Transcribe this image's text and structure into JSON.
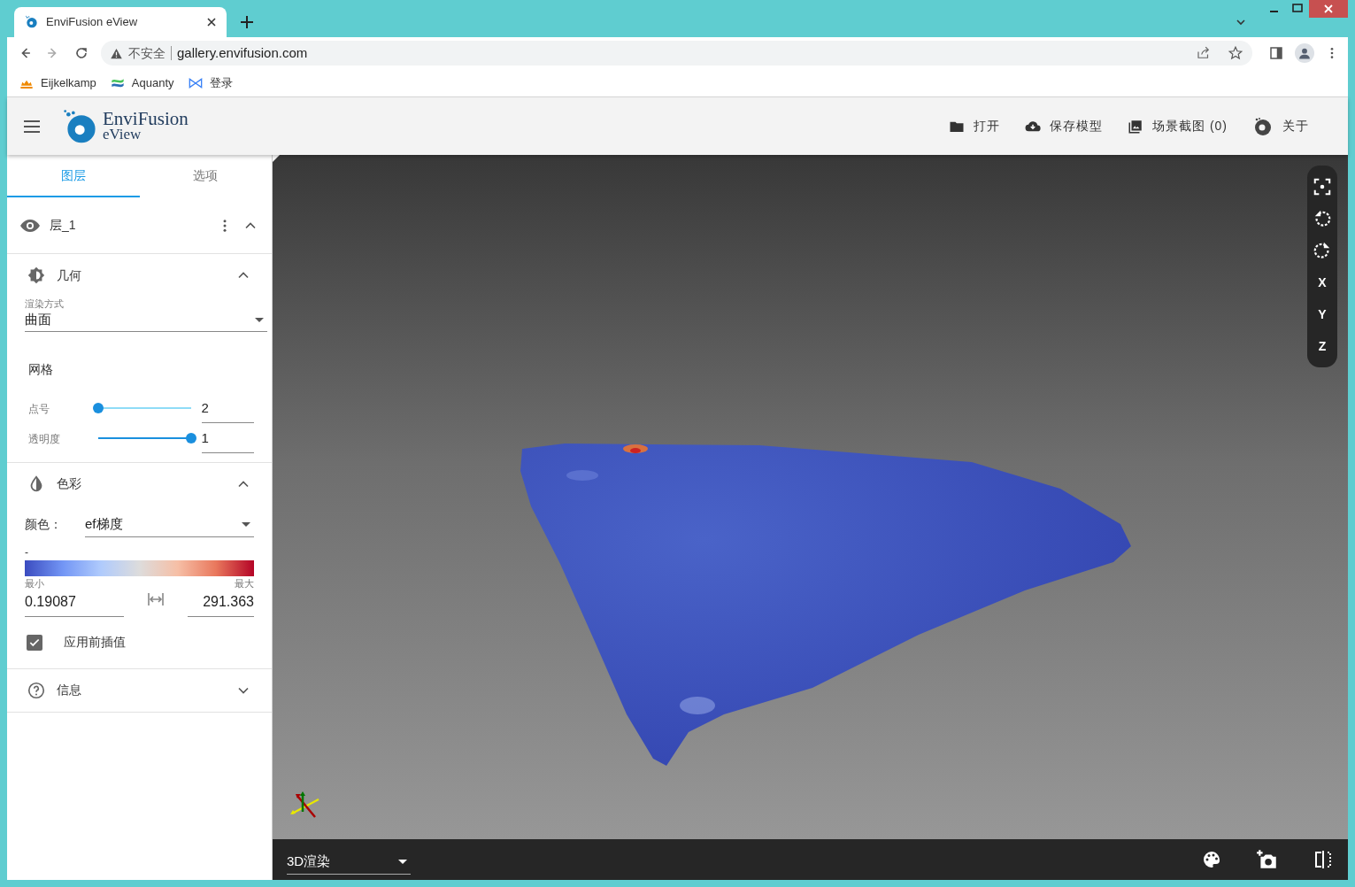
{
  "browser": {
    "tab_title": "EnviFusion eView",
    "security_label": "不安全",
    "url": "gallery.envifusion.com",
    "bookmarks": [
      {
        "label": "Eijkelkamp",
        "kind": "crown"
      },
      {
        "label": "Aquanty",
        "kind": "wave"
      },
      {
        "label": "登录",
        "kind": "bow"
      }
    ]
  },
  "app_header": {
    "logo_title": "EnviFusion",
    "logo_subtitle": "eView",
    "actions": [
      {
        "label": "打开",
        "kind": "folder"
      },
      {
        "label": "保存模型",
        "kind": "cloud"
      },
      {
        "label": "场景截图 (0)",
        "kind": "photos"
      },
      {
        "label": "关于",
        "kind": "logo"
      }
    ]
  },
  "sidebar": {
    "tabs": [
      {
        "label": "图层",
        "selected": true
      },
      {
        "label": "选项",
        "selected": false
      }
    ],
    "layer": {
      "name": "层_1",
      "expanded": true
    },
    "geometry": {
      "title": "几何",
      "expanded": true,
      "render_mode_label": "渲染方式",
      "render_mode": "曲面",
      "mesh_title": "网格",
      "sliders": [
        {
          "label": "点号",
          "level": 0.0,
          "value": "2"
        },
        {
          "label": "透明度",
          "level": 1.0,
          "value": "1"
        }
      ]
    },
    "color": {
      "title": "色彩",
      "expanded": true,
      "color_label": "颜色：",
      "color_map": "ef梯度",
      "legend_title": "-",
      "min_label": "最小",
      "max_label": "最大",
      "min_value": "0.19087",
      "max_value": "291.363",
      "interpolate_label": "应用前插值",
      "interpolate_checked": true
    },
    "info": {
      "title": "信息",
      "expanded": false
    }
  },
  "viewport": {
    "tools": [
      {
        "kind": "fit"
      },
      {
        "kind": "rotate-left"
      },
      {
        "kind": "rotate-right"
      },
      {
        "kind": "text",
        "label": "X"
      },
      {
        "kind": "text",
        "label": "Y"
      },
      {
        "kind": "text",
        "label": "Z"
      }
    ],
    "render_mode": "3D渲染"
  }
}
